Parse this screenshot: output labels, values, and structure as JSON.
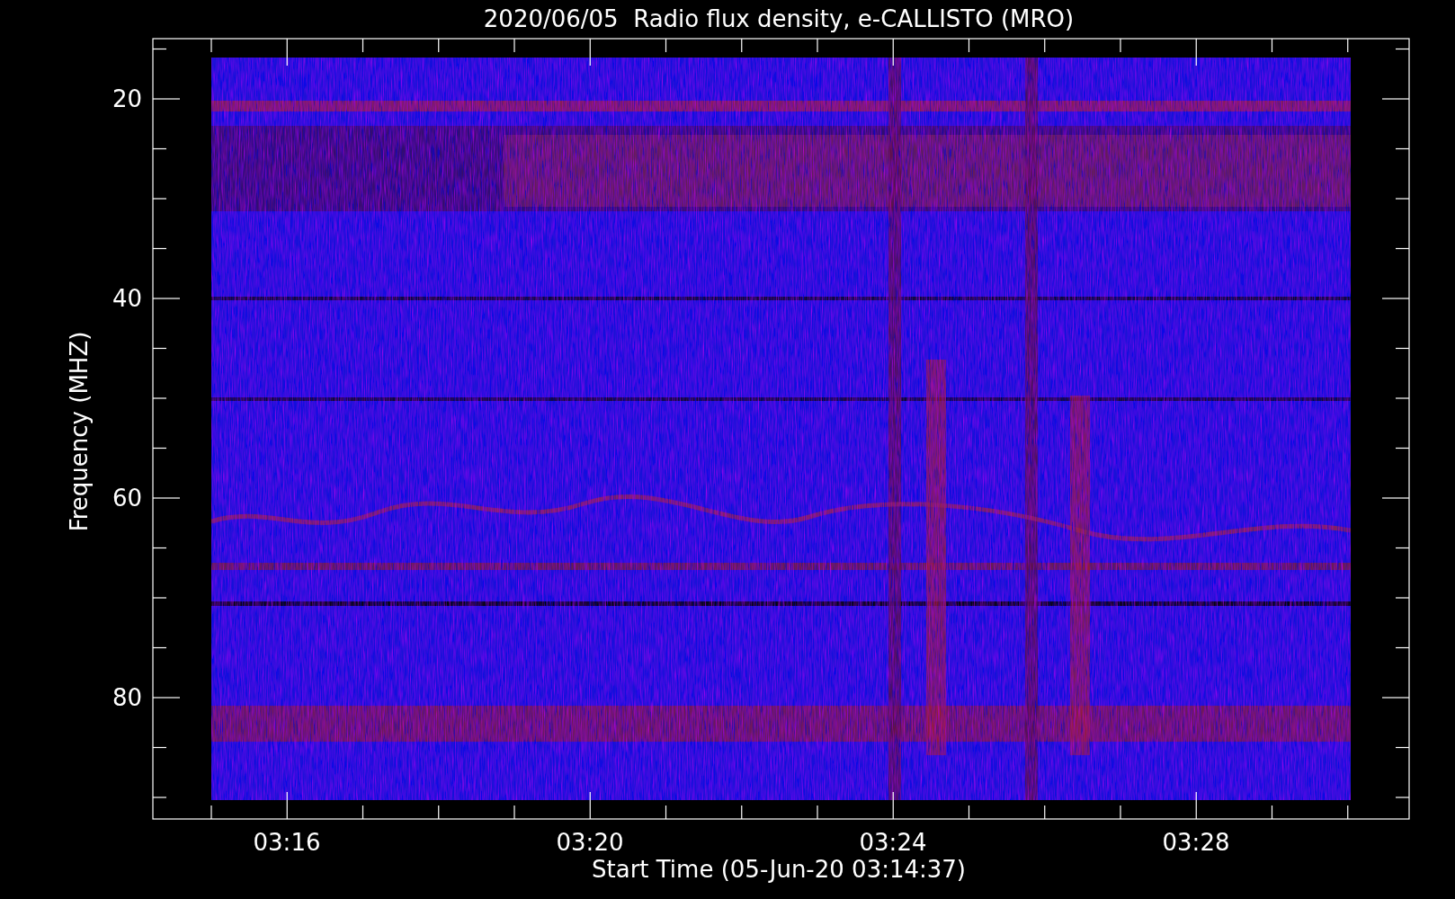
{
  "title": "2020/06/05  Radio flux density, e-CALLISTO (MRO)",
  "y_axis": {
    "label": "Frequency (MHZ)",
    "ticks": [
      "20",
      "40",
      "60",
      "80"
    ]
  },
  "x_axis": {
    "label": "Start Time (05-Jun-20 03:14:37)",
    "ticks": [
      "03:16",
      "03:20",
      "03:24",
      "03:28"
    ]
  }
}
